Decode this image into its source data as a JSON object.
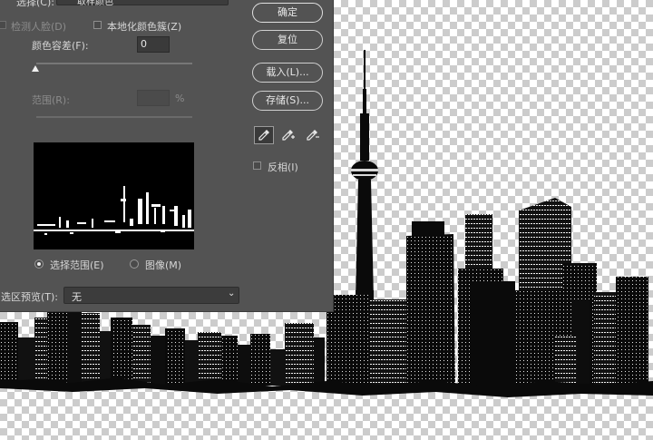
{
  "dialog": {
    "select_label": "选择(C):",
    "select_value": "取样颜色",
    "detect_faces_label": "检测人脸(D)",
    "localized_clusters_label": "本地化颜色簇(Z)",
    "fuzziness_label": "颜色容差(F):",
    "fuzziness_value": "0",
    "range_label": "范围(R):",
    "range_unit": "%",
    "radio_selection_label": "选择范围(E)",
    "radio_image_label": "图像(M)",
    "preview_label": "选区预览(T):",
    "preview_value": "无",
    "buttons": {
      "ok": "确定",
      "reset": "复位",
      "load": "载入(L)...",
      "save": "存储(S)..."
    },
    "invert_label": "反相(I)",
    "icons": {
      "eyedropper": "eyedropper-icon",
      "eyedropper_plus": "eyedropper-plus-icon",
      "eyedropper_minus": "eyedropper-minus-icon",
      "dropdown": "chevron-down-icon"
    }
  },
  "colors": {
    "dialog_bg": "#535353",
    "field_bg": "#3a3a3a",
    "text": "#d6d6d6",
    "canvas_checker": "#cccccc"
  }
}
